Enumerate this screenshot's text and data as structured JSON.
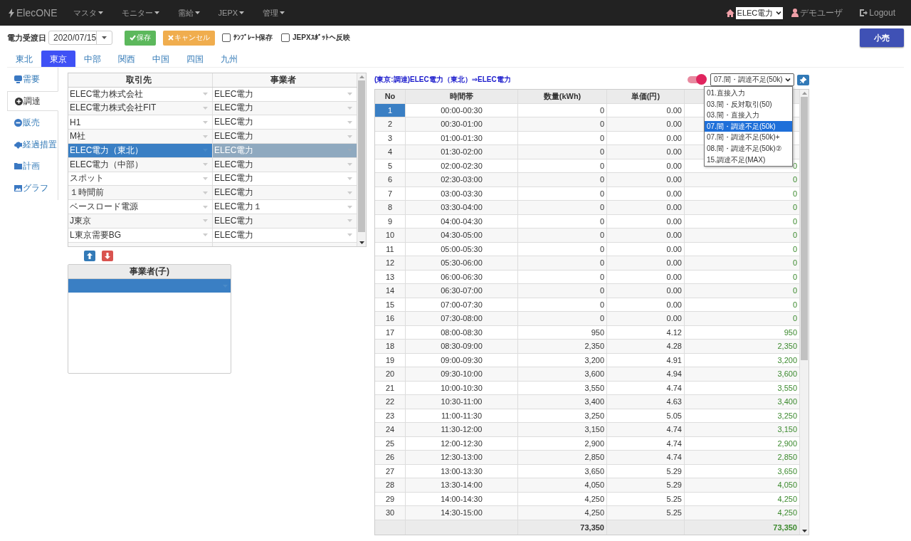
{
  "navbar": {
    "brand": "ElecONE",
    "menus": [
      {
        "label": "マスタ"
      },
      {
        "label": "モニター"
      },
      {
        "label": "需給"
      },
      {
        "label": "JEPX"
      },
      {
        "label": "管理"
      }
    ],
    "company_select": "ELEC電力",
    "user": "デモユーザ",
    "logout": "Logout"
  },
  "toolbar": {
    "date_label": "電力受渡日",
    "date_value": "2020/07/15",
    "save_button": "保存",
    "cancel_button": "キャンセル",
    "checkboxes": [
      {
        "label": "ﾃﾝﾌﾟﾚｰﾄ保存",
        "checked": false
      },
      {
        "label": "JEPXｽﾎﾟｯﾄへ反映",
        "checked": false
      }
    ],
    "right_button": "小売"
  },
  "region_tabs": [
    {
      "label": "東北",
      "selected": false
    },
    {
      "label": "東京",
      "selected": true
    },
    {
      "label": "中部",
      "selected": false
    },
    {
      "label": "関西",
      "selected": false
    },
    {
      "label": "中国",
      "selected": false
    },
    {
      "label": "四国",
      "selected": false
    },
    {
      "label": "九州",
      "selected": false
    }
  ],
  "side_tabs": [
    {
      "label": "需要",
      "selected": false
    },
    {
      "label": "調達",
      "selected": true
    },
    {
      "label": "販売",
      "selected": false
    },
    {
      "label": "経過措置",
      "selected": false
    },
    {
      "label": "計画",
      "selected": false
    },
    {
      "label": "グラフ",
      "selected": false
    }
  ],
  "partners": {
    "columns": [
      "取引先",
      "事業者"
    ],
    "rows": [
      {
        "partner": "ELEC電力株式会社",
        "operator": "ELEC電力",
        "selected": false
      },
      {
        "partner": "ELEC電力株式会社FIT",
        "operator": "ELEC電力",
        "selected": false
      },
      {
        "partner": "H1",
        "operator": "ELEC電力",
        "selected": false
      },
      {
        "partner": "M社",
        "operator": "ELEC電力",
        "selected": false
      },
      {
        "partner": "ELEC電力（東北）",
        "operator": "ELEC電力",
        "selected": true
      },
      {
        "partner": "ELEC電力（中部）",
        "operator": "ELEC電力",
        "selected": false
      },
      {
        "partner": "スポット",
        "operator": "ELEC電力",
        "selected": false
      },
      {
        "partner": "１時間前",
        "operator": "ELEC電力",
        "selected": false
      },
      {
        "partner": "ベースロード電源",
        "operator": "ELEC電力１",
        "selected": false
      },
      {
        "partner": "J東京",
        "operator": "ELEC電力",
        "selected": false
      },
      {
        "partner": "L東京需要BG",
        "operator": "ELEC電力",
        "selected": false
      }
    ]
  },
  "child_grid": {
    "column": "事業者(子)",
    "rows": [
      {
        "selected": true
      }
    ]
  },
  "detail": {
    "title": "(東京:調達)ELEC電力（東北）⇒ELEC電力",
    "toggle": {
      "on": true
    },
    "pattern_select": "07.間・調達不足(50k)",
    "options": [
      {
        "label": "01.直接入力",
        "selected": false
      },
      {
        "label": "03.間・反対取引(50)",
        "selected": false
      },
      {
        "label": "03.間・直接入力",
        "selected": false
      },
      {
        "label": "07.間・調達不足(50k)",
        "selected": true
      },
      {
        "label": "07.間・調達不足(50k)+",
        "selected": false
      },
      {
        "label": "08.間・調達不足(50k)②",
        "selected": false
      },
      {
        "label": "15.調達不足(MAX)",
        "selected": false
      }
    ],
    "columns": [
      "No",
      "時間帯",
      "数量(kWh)",
      "単価(円)"
    ],
    "rows": [
      {
        "no": "1",
        "time": "00:00-00:30",
        "qty": "0",
        "price": "0.00",
        "selected": true
      },
      {
        "no": "2",
        "time": "00:30-01:00",
        "qty": "0",
        "price": "0.00",
        "selected": false
      },
      {
        "no": "3",
        "time": "01:00-01:30",
        "qty": "0",
        "price": "0.00",
        "selected": false
      },
      {
        "no": "4",
        "time": "01:30-02:00",
        "qty": "0",
        "price": "0.00",
        "selected": false
      },
      {
        "no": "5",
        "time": "02:00-02:30",
        "qty": "0",
        "price": "0.00",
        "column_5": "0",
        "selected": false
      },
      {
        "no": "6",
        "time": "02:30-03:00",
        "qty": "0",
        "price": "0.00",
        "column_5": "0",
        "selected": false
      },
      {
        "no": "7",
        "time": "03:00-03:30",
        "qty": "0",
        "price": "0.00",
        "column_5": "0",
        "selected": false
      },
      {
        "no": "8",
        "time": "03:30-04:00",
        "qty": "0",
        "price": "0.00",
        "column_5": "0",
        "selected": false
      },
      {
        "no": "9",
        "time": "04:00-04:30",
        "qty": "0",
        "price": "0.00",
        "column_5": "0",
        "selected": false
      },
      {
        "no": "10",
        "time": "04:30-05:00",
        "qty": "0",
        "price": "0.00",
        "column_5": "0",
        "selected": false
      },
      {
        "no": "11",
        "time": "05:00-05:30",
        "qty": "0",
        "price": "0.00",
        "column_5": "0",
        "selected": false
      },
      {
        "no": "12",
        "time": "05:30-06:00",
        "qty": "0",
        "price": "0.00",
        "column_5": "0",
        "selected": false
      },
      {
        "no": "13",
        "time": "06:00-06:30",
        "qty": "0",
        "price": "0.00",
        "column_5": "0",
        "selected": false
      },
      {
        "no": "14",
        "time": "06:30-07:00",
        "qty": "0",
        "price": "0.00",
        "column_5": "0",
        "selected": false
      },
      {
        "no": "15",
        "time": "07:00-07:30",
        "qty": "0",
        "price": "0.00",
        "column_5": "0",
        "selected": false
      },
      {
        "no": "16",
        "time": "07:30-08:00",
        "qty": "0",
        "price": "0.00",
        "column_5": "0",
        "selected": false
      },
      {
        "no": "17",
        "time": "08:00-08:30",
        "qty": "950",
        "price": "4.12",
        "column_5": "950",
        "selected": false
      },
      {
        "no": "18",
        "time": "08:30-09:00",
        "qty": "2,350",
        "price": "4.28",
        "column_5": "2,350",
        "selected": false
      },
      {
        "no": "19",
        "time": "09:00-09:30",
        "qty": "3,200",
        "price": "4.91",
        "column_5": "3,200",
        "selected": false
      },
      {
        "no": "20",
        "time": "09:30-10:00",
        "qty": "3,600",
        "price": "4.94",
        "column_5": "3,600",
        "selected": false
      },
      {
        "no": "21",
        "time": "10:00-10:30",
        "qty": "3,550",
        "price": "4.74",
        "column_5": "3,550",
        "selected": false
      },
      {
        "no": "22",
        "time": "10:30-11:00",
        "qty": "3,400",
        "price": "4.63",
        "column_5": "3,400",
        "selected": false
      },
      {
        "no": "23",
        "time": "11:00-11:30",
        "qty": "3,250",
        "price": "5.05",
        "column_5": "3,250",
        "selected": false
      },
      {
        "no": "24",
        "time": "11:30-12:00",
        "qty": "3,150",
        "price": "4.74",
        "column_5": "3,150",
        "selected": false
      },
      {
        "no": "25",
        "time": "12:00-12:30",
        "qty": "2,900",
        "price": "4.74",
        "column_5": "2,900",
        "selected": false
      },
      {
        "no": "26",
        "time": "12:30-13:00",
        "qty": "2,850",
        "price": "4.74",
        "column_5": "2,850",
        "selected": false
      },
      {
        "no": "27",
        "time": "13:00-13:30",
        "qty": "3,650",
        "price": "5.29",
        "column_5": "3,650",
        "selected": false
      },
      {
        "no": "28",
        "time": "13:30-14:00",
        "qty": "4,050",
        "price": "5.29",
        "column_5": "4,050",
        "selected": false
      },
      {
        "no": "29",
        "time": "14:00-14:30",
        "qty": "4,250",
        "price": "5.25",
        "column_5": "4,250",
        "selected": false
      },
      {
        "no": "30",
        "time": "14:30-15:00",
        "qty": "4,250",
        "price": "5.25",
        "column_5": "4,250",
        "selected": false
      }
    ],
    "total": {
      "qty": "73,350",
      "column_5": "73,350"
    }
  }
}
